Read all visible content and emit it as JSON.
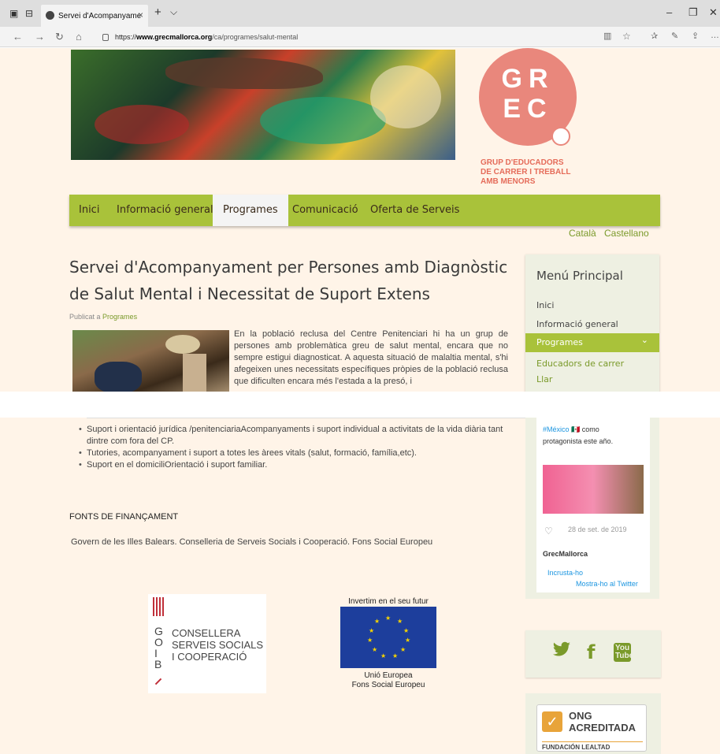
{
  "browser": {
    "tab_title": "Servei d'Acompanyame",
    "tab_close": "×",
    "new_tab": "+",
    "tab_list": "⌵",
    "url_prefix": "https://",
    "url_domain": "www.grecmallorca.org",
    "url_path": "/ca/programes/salut-mental",
    "minimize": "–",
    "restore": "❐",
    "close": "✕"
  },
  "logo": {
    "line1": "GR",
    "line2": "EC",
    "tagline": [
      "GRUP D'EDUCADORS",
      "DE CARRER I TREBALL",
      "AMB MENORS"
    ]
  },
  "menu": {
    "items": [
      "Inici",
      "Informació general",
      "Programes",
      "Comunicació",
      "Oferta de Serveis"
    ],
    "active": "Programes"
  },
  "languages": [
    "Català",
    "Castellano"
  ],
  "post": {
    "title_line1": "Servei d'Acompanyament per Persones amb Diagnòstic",
    "title_line2": "de Salut Mental i Necessitat de Suport Extens",
    "published_prefix": "Publicat a",
    "published_category": "Programes",
    "body": "En la població reclusa del Centre Penitenciari hi ha un grup de persones amb problemàtica greu de salut mental, encara que no sempre estigui diagnosticat. A aquesta situació de malaltia mental, s'hi afegeixen unes necessitats específiques pròpies de la població reclusa que dificulten encara més l'estada a la presó, i"
  },
  "sidebar": {
    "title": "Menú Principal",
    "items": [
      "Inici",
      "Informació general",
      "Programes",
      "Educadors de carrer",
      "Llar"
    ],
    "active": "Programes",
    "active_chevron": "⌄"
  },
  "bullets": [
    "Suport i orientació jurídica /penitenciariaAcompanyaments i suport  individual a activitats de la vida diària tant dintre com fora del CP.",
    "Tutories, acompanyament i suport a totes les àrees vitals (salut, formació, família,etc).",
    "Suport en el domiciliOrientació i suport familiar."
  ],
  "funding": {
    "heading": "FONTS DE FINANÇAMENT",
    "text": "Govern de les Illes Balears. Conselleria de Serveis Socials i Cooperació. Fons Social Europeu"
  },
  "goib": {
    "letters": [
      "G",
      "O",
      "I",
      "B"
    ],
    "name": [
      "CONSELLERA",
      "SERVEIS SOCIALS",
      "I COOPERACIÓ"
    ]
  },
  "eu": {
    "caption_top": "Invertim en el seu futur",
    "caption_bottom1": "Unió Europea",
    "caption_bottom2": "Fons Social Europeu"
  },
  "twitter": {
    "hashtag": "#México",
    "flag": "🇲🇽",
    "text1": " como",
    "text2": "protagonista este año.",
    "date": "28 de set. de 2019",
    "user": "GrecMallorca",
    "embed": "Incrusta-ho",
    "view": "Mostra-ho al Twitter"
  },
  "social": {
    "twitter": "t",
    "facebook": "f",
    "youtube_1": "You",
    "youtube_2": "Tube"
  },
  "ong": {
    "check": "✓",
    "line1": "ONG",
    "line2": "ACREDITADA",
    "foundation": "FUNDACIÓN LEALTAD"
  }
}
